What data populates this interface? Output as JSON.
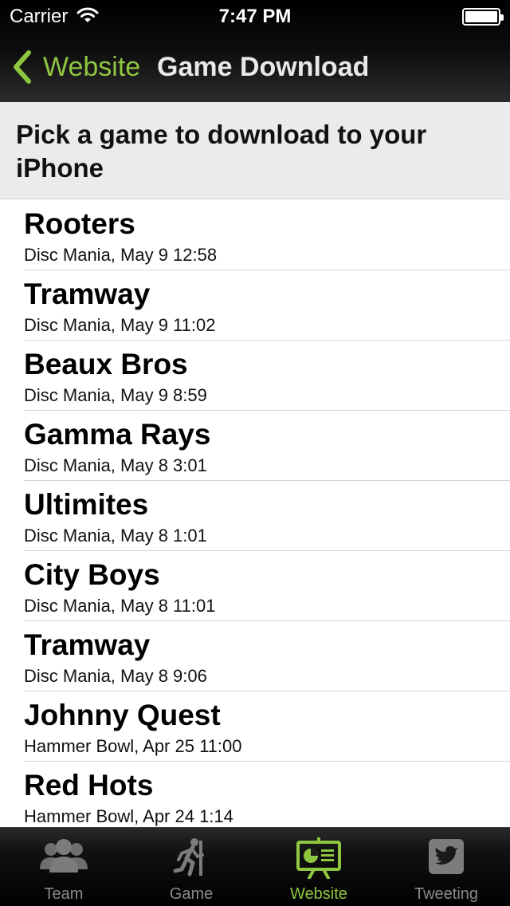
{
  "status_bar": {
    "carrier": "Carrier",
    "time": "7:47 PM"
  },
  "nav": {
    "back_label": "Website",
    "title": "Game Download"
  },
  "header": {
    "prompt": "Pick a game to download to your iPhone"
  },
  "games": [
    {
      "opponent": "Rooters",
      "details": "Disc Mania, May 9 12:58"
    },
    {
      "opponent": "Tramway",
      "details": "Disc Mania, May 9 11:02"
    },
    {
      "opponent": "Beaux Bros",
      "details": "Disc Mania, May 9 8:59"
    },
    {
      "opponent": "Gamma Rays",
      "details": "Disc Mania, May 8 3:01"
    },
    {
      "opponent": "Ultimites",
      "details": "Disc Mania, May 8 1:01"
    },
    {
      "opponent": "City Boys",
      "details": "Disc Mania, May 8 11:01"
    },
    {
      "opponent": "Tramway",
      "details": "Disc Mania, May 8 9:06"
    },
    {
      "opponent": "Johnny Quest",
      "details": "Hammer Bowl, Apr 25 11:00"
    },
    {
      "opponent": "Red Hots",
      "details": "Hammer Bowl, Apr 24 1:14"
    }
  ],
  "tabs": [
    {
      "label": "Team",
      "icon": "team-icon",
      "active": false
    },
    {
      "label": "Game",
      "icon": "runner-icon",
      "active": false
    },
    {
      "label": "Website",
      "icon": "presentation-icon",
      "active": true
    },
    {
      "label": "Tweeting",
      "icon": "twitter-bird-icon",
      "active": false
    }
  ],
  "colors": {
    "accent": "#8fc63f",
    "inactive_tab": "#8a8a8a",
    "nav_bg": "#1a1a1a",
    "header_bg": "#ebebeb"
  }
}
